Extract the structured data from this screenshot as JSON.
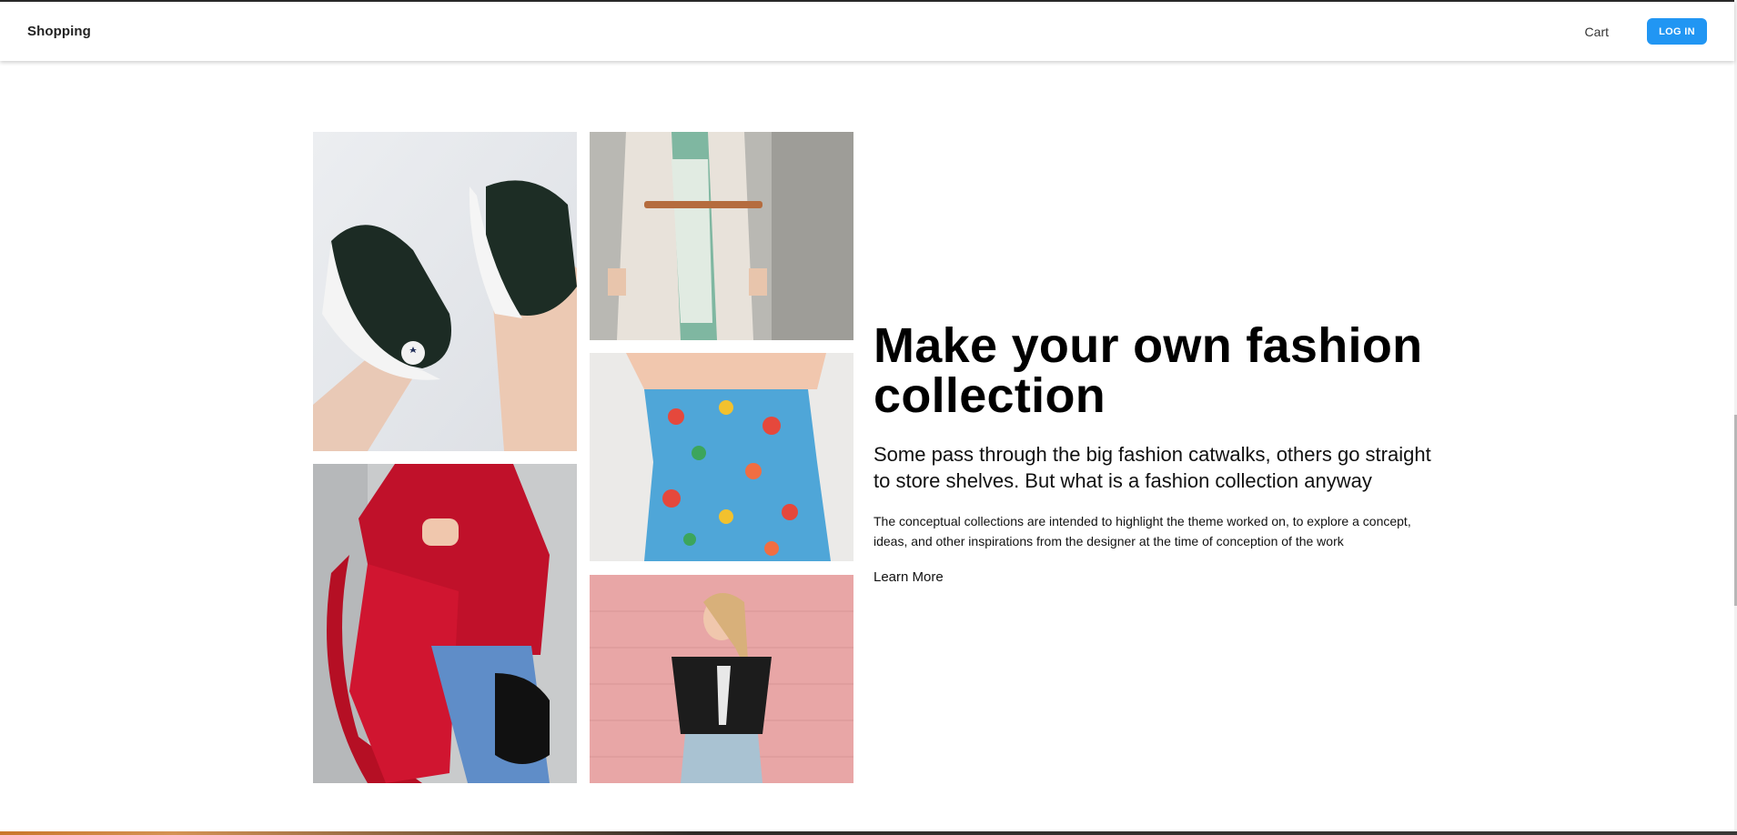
{
  "header": {
    "brand": "Shopping",
    "cart_label": "Cart",
    "login_label": "LOG IN"
  },
  "gallery": {
    "tiles": [
      {
        "subject": "sneakers",
        "icon": "sneakers-photo"
      },
      {
        "subject": "red-sweater",
        "icon": "red-sweater-photo"
      },
      {
        "subject": "white-coat",
        "icon": "white-coat-photo"
      },
      {
        "subject": "floral-dress",
        "icon": "floral-dress-photo"
      },
      {
        "subject": "pink-wall-tshirt",
        "icon": "pink-wall-photo"
      }
    ]
  },
  "hero": {
    "headline": "Make your own fashion collection",
    "subheadline": "Some pass through the big fashion catwalks, others go straight to store shelves. But what is a fashion collection anyway",
    "body": "The conceptual collections are intended to highlight the theme worked on, to explore a concept, ideas, and other inspirations from the designer at the time of conception of the work",
    "cta_label": "Learn More"
  },
  "colors": {
    "accent": "#2196f3",
    "text": "#111111",
    "background": "#ffffff"
  }
}
